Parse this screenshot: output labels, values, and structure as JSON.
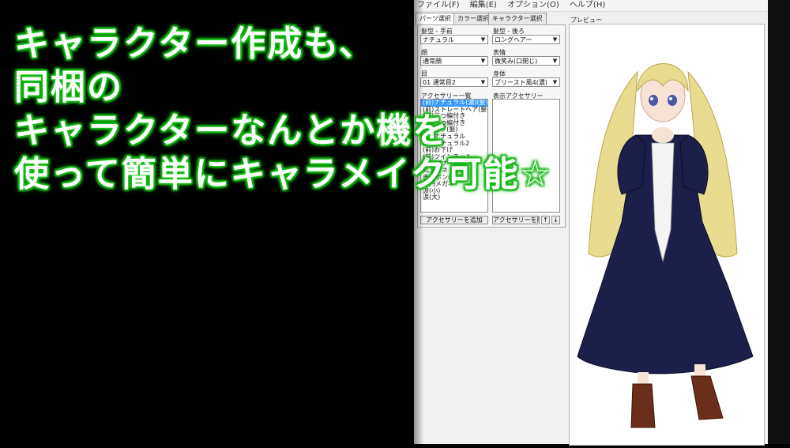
{
  "caption": {
    "line1": "キャラクター作成も、",
    "line2": "同梱の",
    "line3": "キャラクターなんとか機を",
    "line4": "使って簡単にキャラメイク可能",
    "star": "☆"
  },
  "menu": [
    "ファイル(F)",
    "編集(E)",
    "オプション(O)",
    "ヘルプ(H)"
  ],
  "tabs": [
    "パーツ選択",
    "カラー選択",
    "キャラクター選択"
  ],
  "form": {
    "hair_front_label": "髪型 - 手前",
    "hair_front_value": "ナチュラル",
    "hair_back_label": "髪型 - 後ろ",
    "hair_back_value": "ロングヘアー",
    "face_label": "顔",
    "face_value": "通常顔",
    "expression_label": "表情",
    "expression_value": "微笑み(口閉じ)",
    "eyes_label": "目",
    "eyes_value": "01 通常目2",
    "body_label": "身体",
    "body_value": "ブリースト風4(濃)",
    "accessory_list_label": "アクセサリー一覧",
    "shown_accessory_label": "表示アクセサリー",
    "accessories": [
      "(前)ナチュラル(濃)(髪)",
      "(前)ストレートヘア(髪)",
      "(前)三つ編付き",
      "(前)三つ編付き",
      "(前)ボブ(髪)",
      "(前)ナチュラル",
      "(前)ナチュラル2",
      "(前)お下げ",
      "(前)ツインテール",
      "バンダナ",
      "丸メガネ",
      "赤リボン(頭上)",
      "楕円メガネ",
      "涙(小)",
      "涙(大)"
    ],
    "add_button": "アクセサリーを追加",
    "delete_button": "アクセサリーを削除",
    "up_button": "↑",
    "down_button": "↓"
  },
  "preview_label": "プレビュー",
  "colors": {
    "caption_glow": "#1fd11f",
    "selection": "#3399ff",
    "dress": "#1c1f4a",
    "hair": "#e8dc90"
  }
}
